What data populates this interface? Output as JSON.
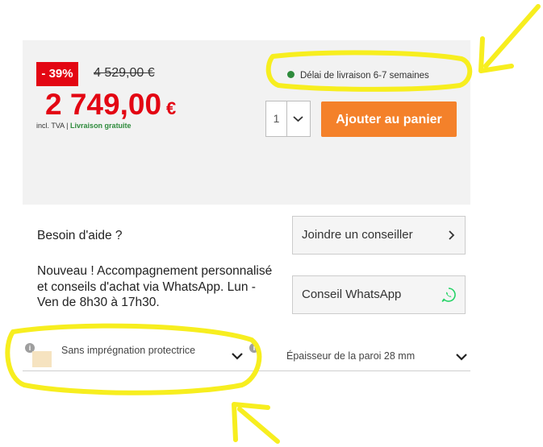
{
  "pricing": {
    "discount": "- 39%",
    "old_price": "4 529,00 €",
    "price": "2 749,00",
    "currency": "€",
    "tax_note": "incl. TVA |",
    "free_shipping": "Livraison gratuite"
  },
  "delivery": {
    "label": "Délai de livraison 6-7 semaines",
    "status_color": "#2e8b3c"
  },
  "purchase": {
    "quantity": "1",
    "add_to_cart": "Ajouter au panier",
    "accent": "#f4812a"
  },
  "help": {
    "label": "Besoin d'aide ?",
    "button": "Joindre un conseiller"
  },
  "whatsapp": {
    "text": "Nouveau ! Accompagnement personnalisé et conseils d'achat via WhatsApp. Lun - Ven de 8h30 à 17h30.",
    "button": "Conseil WhatsApp",
    "icon": "whatsapp-icon"
  },
  "options": [
    {
      "label": "Sans imprégnation protectrice",
      "icon": "info-icon"
    },
    {
      "label": "Épaisseur de la paroi 28 mm",
      "icon": "info-icon"
    }
  ],
  "colors": {
    "price_red": "#e30613",
    "highlight": "#f7ee1f"
  }
}
